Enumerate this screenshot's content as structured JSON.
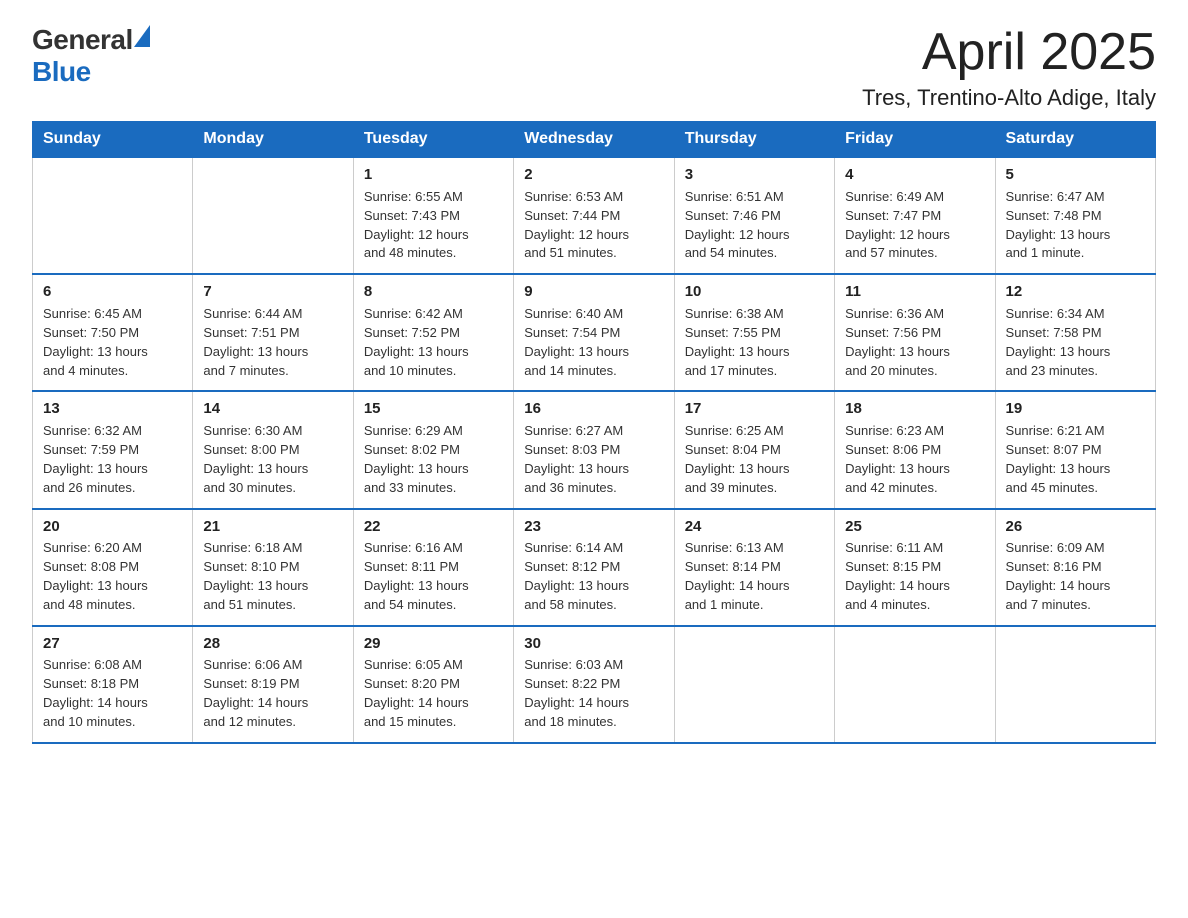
{
  "header": {
    "logo_general": "General",
    "logo_blue": "Blue",
    "month_title": "April 2025",
    "location": "Tres, Trentino-Alto Adige, Italy"
  },
  "days_of_week": [
    "Sunday",
    "Monday",
    "Tuesday",
    "Wednesday",
    "Thursday",
    "Friday",
    "Saturday"
  ],
  "weeks": [
    [
      {
        "day": "",
        "info": ""
      },
      {
        "day": "",
        "info": ""
      },
      {
        "day": "1",
        "info": "Sunrise: 6:55 AM\nSunset: 7:43 PM\nDaylight: 12 hours\nand 48 minutes."
      },
      {
        "day": "2",
        "info": "Sunrise: 6:53 AM\nSunset: 7:44 PM\nDaylight: 12 hours\nand 51 minutes."
      },
      {
        "day": "3",
        "info": "Sunrise: 6:51 AM\nSunset: 7:46 PM\nDaylight: 12 hours\nand 54 minutes."
      },
      {
        "day": "4",
        "info": "Sunrise: 6:49 AM\nSunset: 7:47 PM\nDaylight: 12 hours\nand 57 minutes."
      },
      {
        "day": "5",
        "info": "Sunrise: 6:47 AM\nSunset: 7:48 PM\nDaylight: 13 hours\nand 1 minute."
      }
    ],
    [
      {
        "day": "6",
        "info": "Sunrise: 6:45 AM\nSunset: 7:50 PM\nDaylight: 13 hours\nand 4 minutes."
      },
      {
        "day": "7",
        "info": "Sunrise: 6:44 AM\nSunset: 7:51 PM\nDaylight: 13 hours\nand 7 minutes."
      },
      {
        "day": "8",
        "info": "Sunrise: 6:42 AM\nSunset: 7:52 PM\nDaylight: 13 hours\nand 10 minutes."
      },
      {
        "day": "9",
        "info": "Sunrise: 6:40 AM\nSunset: 7:54 PM\nDaylight: 13 hours\nand 14 minutes."
      },
      {
        "day": "10",
        "info": "Sunrise: 6:38 AM\nSunset: 7:55 PM\nDaylight: 13 hours\nand 17 minutes."
      },
      {
        "day": "11",
        "info": "Sunrise: 6:36 AM\nSunset: 7:56 PM\nDaylight: 13 hours\nand 20 minutes."
      },
      {
        "day": "12",
        "info": "Sunrise: 6:34 AM\nSunset: 7:58 PM\nDaylight: 13 hours\nand 23 minutes."
      }
    ],
    [
      {
        "day": "13",
        "info": "Sunrise: 6:32 AM\nSunset: 7:59 PM\nDaylight: 13 hours\nand 26 minutes."
      },
      {
        "day": "14",
        "info": "Sunrise: 6:30 AM\nSunset: 8:00 PM\nDaylight: 13 hours\nand 30 minutes."
      },
      {
        "day": "15",
        "info": "Sunrise: 6:29 AM\nSunset: 8:02 PM\nDaylight: 13 hours\nand 33 minutes."
      },
      {
        "day": "16",
        "info": "Sunrise: 6:27 AM\nSunset: 8:03 PM\nDaylight: 13 hours\nand 36 minutes."
      },
      {
        "day": "17",
        "info": "Sunrise: 6:25 AM\nSunset: 8:04 PM\nDaylight: 13 hours\nand 39 minutes."
      },
      {
        "day": "18",
        "info": "Sunrise: 6:23 AM\nSunset: 8:06 PM\nDaylight: 13 hours\nand 42 minutes."
      },
      {
        "day": "19",
        "info": "Sunrise: 6:21 AM\nSunset: 8:07 PM\nDaylight: 13 hours\nand 45 minutes."
      }
    ],
    [
      {
        "day": "20",
        "info": "Sunrise: 6:20 AM\nSunset: 8:08 PM\nDaylight: 13 hours\nand 48 minutes."
      },
      {
        "day": "21",
        "info": "Sunrise: 6:18 AM\nSunset: 8:10 PM\nDaylight: 13 hours\nand 51 minutes."
      },
      {
        "day": "22",
        "info": "Sunrise: 6:16 AM\nSunset: 8:11 PM\nDaylight: 13 hours\nand 54 minutes."
      },
      {
        "day": "23",
        "info": "Sunrise: 6:14 AM\nSunset: 8:12 PM\nDaylight: 13 hours\nand 58 minutes."
      },
      {
        "day": "24",
        "info": "Sunrise: 6:13 AM\nSunset: 8:14 PM\nDaylight: 14 hours\nand 1 minute."
      },
      {
        "day": "25",
        "info": "Sunrise: 6:11 AM\nSunset: 8:15 PM\nDaylight: 14 hours\nand 4 minutes."
      },
      {
        "day": "26",
        "info": "Sunrise: 6:09 AM\nSunset: 8:16 PM\nDaylight: 14 hours\nand 7 minutes."
      }
    ],
    [
      {
        "day": "27",
        "info": "Sunrise: 6:08 AM\nSunset: 8:18 PM\nDaylight: 14 hours\nand 10 minutes."
      },
      {
        "day": "28",
        "info": "Sunrise: 6:06 AM\nSunset: 8:19 PM\nDaylight: 14 hours\nand 12 minutes."
      },
      {
        "day": "29",
        "info": "Sunrise: 6:05 AM\nSunset: 8:20 PM\nDaylight: 14 hours\nand 15 minutes."
      },
      {
        "day": "30",
        "info": "Sunrise: 6:03 AM\nSunset: 8:22 PM\nDaylight: 14 hours\nand 18 minutes."
      },
      {
        "day": "",
        "info": ""
      },
      {
        "day": "",
        "info": ""
      },
      {
        "day": "",
        "info": ""
      }
    ]
  ]
}
